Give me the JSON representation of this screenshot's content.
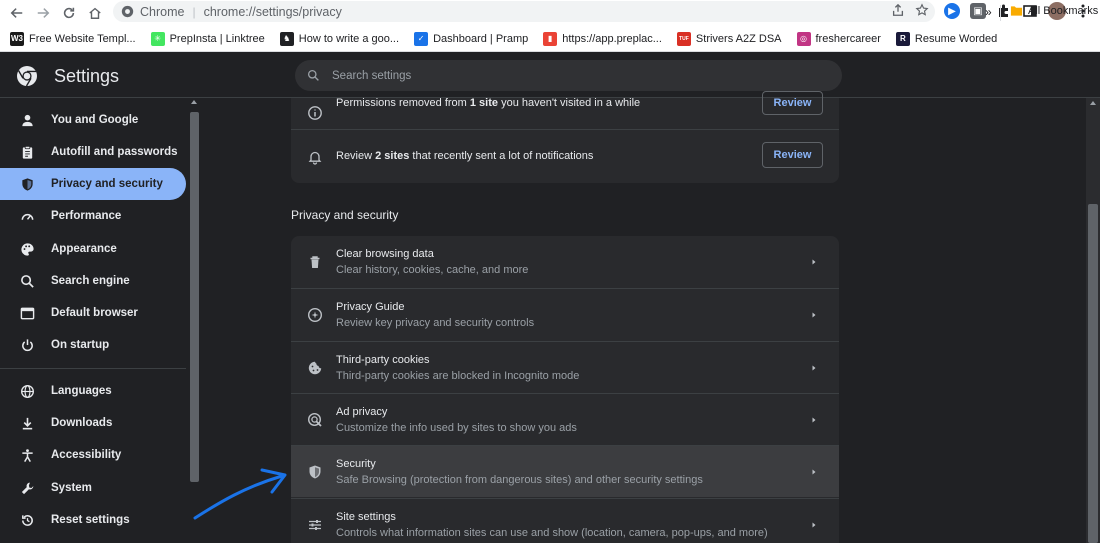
{
  "browser": {
    "site_label": "Chrome",
    "url": "chrome://settings/privacy"
  },
  "bookmarks": [
    {
      "label": "Free Website Templ...",
      "icon": "w3-icon",
      "color": "#1a1a1a",
      "glyph": "W3"
    },
    {
      "label": "PrepInsta | Linktree",
      "icon": "linktree-icon",
      "color": "#43e660",
      "glyph": "✳"
    },
    {
      "label": "How to write a goo...",
      "icon": "llama-icon",
      "color": "#202124",
      "glyph": "♞"
    },
    {
      "label": "Dashboard | Pramp",
      "icon": "pramp-icon",
      "color": "#1a73e8",
      "glyph": "✓"
    },
    {
      "label": "https://app.preplac...",
      "icon": "preplaced-icon",
      "color": "#ea4335",
      "glyph": "▮"
    },
    {
      "label": "Strivers A2Z DSA",
      "icon": "tuf-icon",
      "color": "#d93025",
      "glyph": "TUF"
    },
    {
      "label": "freshercareer",
      "icon": "instagram-icon",
      "color": "#c13584",
      "glyph": "◎"
    },
    {
      "label": "Resume Worded",
      "icon": "resume-worded-icon",
      "color": "#1a1a3a",
      "glyph": "R"
    }
  ],
  "bookmarks_overflow": "»",
  "bookmarks_all": "All Bookmarks",
  "settings": {
    "title": "Settings",
    "search_placeholder": "Search settings"
  },
  "sidebar": {
    "items": [
      {
        "label": "You and Google",
        "icon": "person-icon",
        "active": false
      },
      {
        "label": "Autofill and passwords",
        "icon": "clipboard-icon",
        "active": false
      },
      {
        "label": "Privacy and security",
        "icon": "shield-icon",
        "active": true
      },
      {
        "label": "Performance",
        "icon": "speedometer-icon",
        "active": false
      },
      {
        "label": "Appearance",
        "icon": "palette-icon",
        "active": false
      },
      {
        "label": "Search engine",
        "icon": "search-icon",
        "active": false
      },
      {
        "label": "Default browser",
        "icon": "browser-window-icon",
        "active": false
      },
      {
        "label": "On startup",
        "icon": "power-icon",
        "active": false
      },
      {
        "label": "Languages",
        "icon": "globe-icon",
        "active": false
      },
      {
        "label": "Downloads",
        "icon": "download-icon",
        "active": false
      },
      {
        "label": "Accessibility",
        "icon": "accessibility-icon",
        "active": false
      },
      {
        "label": "System",
        "icon": "wrench-icon",
        "active": false
      },
      {
        "label": "Reset settings",
        "icon": "reset-icon",
        "active": false
      }
    ]
  },
  "safety_check": {
    "permissions_pre": "Permissions removed from ",
    "permissions_bold": "1 site",
    "permissions_post": " you haven't visited in a while",
    "notifications_pre": "Review ",
    "notifications_bold": "2 sites",
    "notifications_post": " that recently sent a lot of notifications",
    "review_label": "Review"
  },
  "privacy_section": {
    "title": "Privacy and security",
    "items": [
      {
        "title": "Clear browsing data",
        "subtitle": "Clear history, cookies, cache, and more",
        "icon": "trash-icon"
      },
      {
        "title": "Privacy Guide",
        "subtitle": "Review key privacy and security controls",
        "icon": "compass-icon"
      },
      {
        "title": "Third-party cookies",
        "subtitle": "Third-party cookies are blocked in Incognito mode",
        "icon": "cookie-icon"
      },
      {
        "title": "Ad privacy",
        "subtitle": "Customize the info used by sites to show you ads",
        "icon": "ad-privacy-icon"
      },
      {
        "title": "Security",
        "subtitle": "Safe Browsing (protection from dangerous sites) and other security settings",
        "icon": "shield-icon",
        "highlighted": true
      },
      {
        "title": "Site settings",
        "subtitle": "Controls what information sites can use and show (location, camera, pop-ups, and more)",
        "icon": "sliders-icon"
      }
    ]
  },
  "colors": {
    "accent": "#8ab4f8",
    "background": "#202124",
    "card": "#292a2d",
    "annotation_arrow": "#1a73e8"
  }
}
